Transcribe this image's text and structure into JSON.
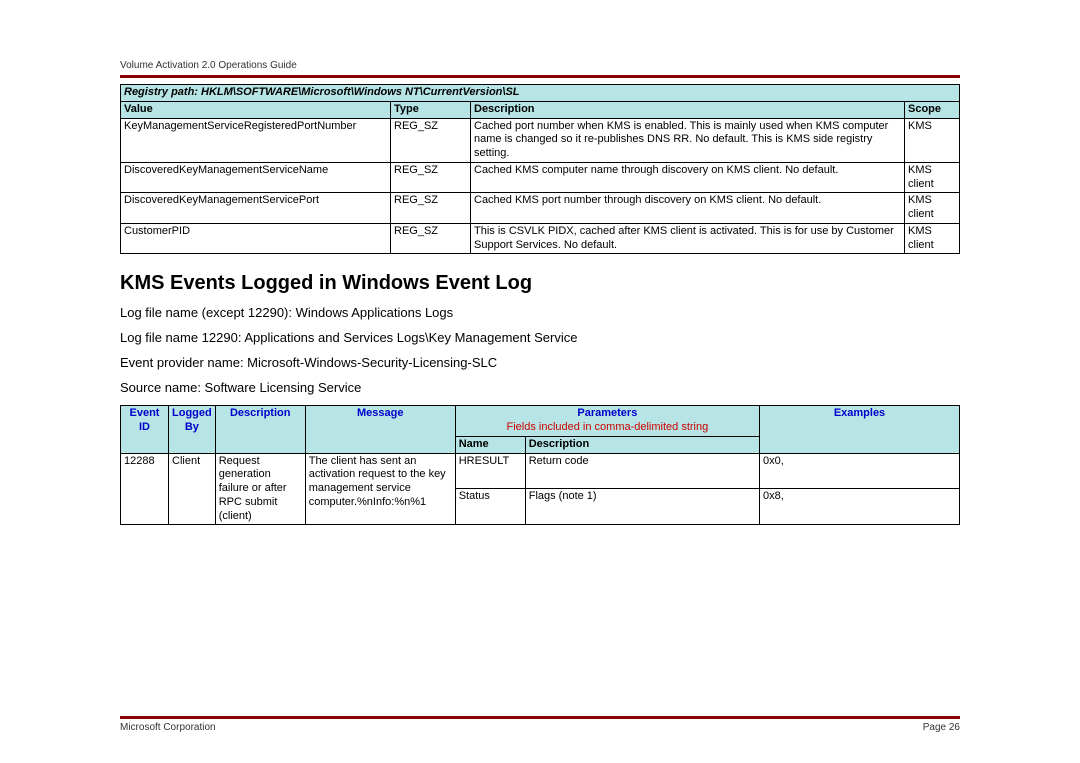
{
  "doc_header": "Volume Activation 2.0 Operations Guide",
  "reg_path_label": "Registry path: HKLM\\SOFTWARE\\Microsoft\\Windows NT\\CurrentVersion\\SL",
  "reg_cols": {
    "c1": "Value",
    "c2": "Type",
    "c3": "Description",
    "c4": "Scope"
  },
  "reg_rows": [
    {
      "value": "KeyManagementServiceRegisteredPortNumber",
      "type": "REG_SZ",
      "desc": "Cached port number when KMS is enabled. This is mainly used when KMS computer name is changed so it re-publishes DNS RR. No default. This is KMS side registry setting.",
      "scope": "KMS"
    },
    {
      "value": "DiscoveredKeyManagementServiceName",
      "type": "REG_SZ",
      "desc": "Cached KMS computer name through discovery on KMS client. No default.",
      "scope": "KMS client"
    },
    {
      "value": "DiscoveredKeyManagementServicePort",
      "type": "REG_SZ",
      "desc": "Cached KMS port number through discovery on KMS client. No default.",
      "scope": "KMS client"
    },
    {
      "value": "CustomerPID",
      "type": "REG_SZ",
      "desc": "This is CSVLK PIDX, cached after KMS client is activated. This is for use by Customer Support Services. No default.",
      "scope": "KMS client"
    }
  ],
  "section_title": "KMS Events Logged in Windows Event Log",
  "para1": "Log file name (except 12290):  Windows Applications Logs",
  "para2": "Log file name 12290:  Applications and Services Logs\\Key Management Service",
  "para3": "Event provider name:  Microsoft-Windows-Security-Licensing-SLC",
  "para4": "Source name:  Software Licensing Service",
  "evt_cols": {
    "c1": "Event ID",
    "c2": "Logged By",
    "c3": "Description",
    "c4": "Message",
    "c5": "Parameters",
    "c5sub": "Fields included in comma-delimited string",
    "c5a": "Name",
    "c5b": "Description",
    "c6": "Examples"
  },
  "evt_row": {
    "id": "12288",
    "by": "Client",
    "desc": "Request generation failure or after RPC submit (client)",
    "msg": "The client has sent an activation request to the key management service computer.%nInfo:%n%1",
    "p1_name": "HRESULT",
    "p1_desc": "Return code",
    "p1_ex": "0x0,",
    "p2_name": "Status",
    "p2_desc": "Flags (note 1)",
    "p2_ex": "0x8,"
  },
  "footer_left": "Microsoft Corporation",
  "footer_right": "Page 26"
}
